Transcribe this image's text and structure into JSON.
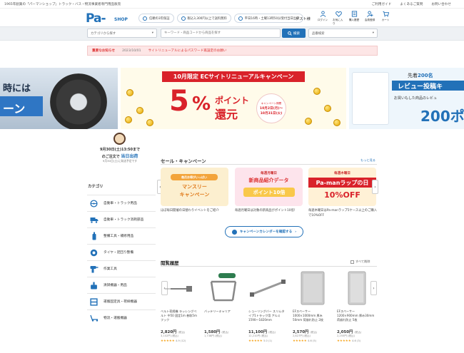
{
  "topbar": {
    "tagline": "1965年創業の「パーマンショップ」トラック・バス・物流事業者専門用品販売",
    "links": [
      "ご利用ガイド",
      "よくあるご質問",
      "お問い合わせ"
    ]
  },
  "header": {
    "logo": "Pa-man",
    "logo_shop": "SHOP",
    "pills": [
      "信頼の3年保証",
      "税込3,300円以上で送料無料",
      "平日16時・土曜13時50分受付当日出荷"
    ],
    "guest": "ゲスト様",
    "icons": [
      {
        "label": "ログイン",
        "icon": "user-icon"
      },
      {
        "label": "お気に入り",
        "icon": "heart-icon"
      },
      {
        "label": "購入履歴",
        "icon": "history-icon"
      },
      {
        "label": "会員登録",
        "icon": "register-icon"
      },
      {
        "label": "カート",
        "icon": "cart-icon"
      }
    ]
  },
  "search": {
    "category_select": "カテゴリから探す",
    "placeholder": "キーワード・商品コードから商品を探す",
    "button": "検索",
    "sort_select": "品番検索"
  },
  "notice": {
    "label": "重要なお知らせ",
    "date": "2023/10/01",
    "text": "サイトリニューアルによるパスワード再設定のお願い"
  },
  "banners": {
    "left": {
      "line1": "時には",
      "line2": "ーン"
    },
    "main": {
      "ribbon": "10月限定 ECサイトリニューアルキャンペーン",
      "big": "5",
      "pct": "%",
      "point": "ポイント",
      "kangen": "還元",
      "period_label": "キャンペーン期間",
      "period_start": "10月2日(月)～",
      "period_end": "10月31日(火)"
    },
    "right": {
      "line1_prefix": "先着",
      "line1_num": "200名",
      "line2": "レビュー投稿キ",
      "line3": "お買いもした商品のレビュ",
      "line4": "200ポ"
    }
  },
  "shipping": {
    "line1": "9月30日(土)13:50まで",
    "line2_prefix": "のご注文で",
    "line2_highlight": "当日出荷",
    "line3": "9月30日(土)に発送予定です"
  },
  "categories": {
    "title": "カテゴリ",
    "items": [
      {
        "label": "自動車・トラック用品",
        "icon": "steering-wheel-icon"
      },
      {
        "label": "自動車・トラック消耗部品",
        "icon": "truck-icon"
      },
      {
        "label": "整備工具・補修用品",
        "icon": "spray-can-icon"
      },
      {
        "label": "タイヤ・足回り整備",
        "icon": "tire-icon"
      },
      {
        "label": "作業工具",
        "icon": "drill-icon"
      },
      {
        "label": "清掃機器・用品",
        "icon": "cleaning-icon"
      },
      {
        "label": "運搬固定具・荷締機器",
        "icon": "cargo-icon"
      },
      {
        "label": "物流・運搬機器",
        "icon": "pallet-truck-icon"
      }
    ]
  },
  "sale": {
    "title": "セール・キャンペーン",
    "see_more": "もっと見る",
    "cards": [
      {
        "tag": "毎月お得がいっぱい",
        "line1": "マンスリー",
        "line2": "キャンペーン",
        "desc": "ほぼ毎日開催の日替わりイベントをご紹介"
      },
      {
        "tag": "毎週月曜日",
        "line1": "新商品紹介データ",
        "line2": "ポイント10倍",
        "desc": "毎週月曜日は対象の新商品がポイント10倍！"
      },
      {
        "tag": "毎週木曜日",
        "line1": "Pa-manラップの日",
        "line2": "10%OFF",
        "desc": "毎週木曜日はPa-manラップ5ケース以上のご購入で10%OFF"
      }
    ],
    "calendar_button": "キャンペーンカレンダーを確認する"
  },
  "history": {
    "title": "閲覧履歴",
    "delete_label": "すべて削除",
    "products": [
      {
        "name": "ベルト荷締機 ラッシングベルト 中50 固定1m 巻取5mフック",
        "price": "2,820円",
        "tax_note": "(税込)",
        "sub": "3,102円 (税込)",
        "stars": "★★★★★",
        "score": "4.9 (12)"
      },
      {
        "name": "バッテリーキャリア",
        "price": "1,580円",
        "tax_note": "(税込)",
        "sub": "1,738円 (税込)",
        "stars": "",
        "score": ""
      },
      {
        "name": "ショーリングバー スリムタイプ1トラック用 アルミ 1590～1820mm",
        "price": "11,100円",
        "tax_note": "(税込)",
        "sub": "12,210円 (税込)",
        "stars": "★★★★★",
        "score": "5.0 (1)"
      },
      {
        "name": "EFスペーサー 1000×1000mm 厚み50mm 荷崩れ防止 2枚",
        "price": "2,570円",
        "tax_note": "(税込)",
        "sub": "2,827円 (税込)",
        "stars": "★★★★★",
        "score": "4.6 (5)"
      },
      {
        "name": "EFスペーサー 1200×900mm 厚み30mm 荷崩れ防止 5枚",
        "price": "2,050円",
        "tax_note": "(税込)",
        "sub": "2,255円 (税込)",
        "stars": "★★★★★",
        "score": "4.6 (3)"
      }
    ]
  },
  "colors": {
    "brand": "#2271b8",
    "alert": "#d9222a"
  }
}
